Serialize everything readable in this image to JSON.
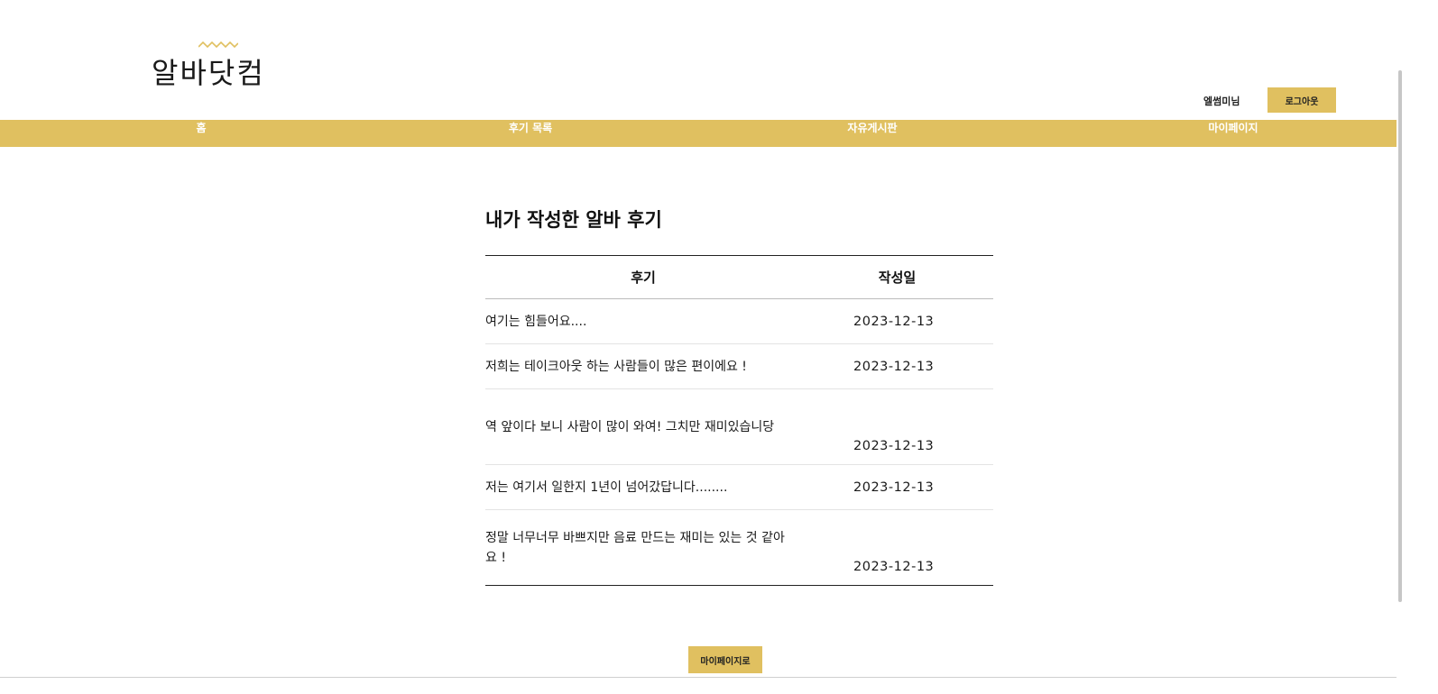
{
  "logo": {
    "text": "알바닷컴",
    "icon": "wave-icon"
  },
  "header": {
    "user_name": "엘썸미님",
    "logout_label": "로그아웃"
  },
  "nav": {
    "items": [
      {
        "label": "홈"
      },
      {
        "label": "후기 목록"
      },
      {
        "label": "자유게시판"
      },
      {
        "label": "마이페이지"
      }
    ]
  },
  "main": {
    "title": "내가 작성한 알바 후기",
    "table": {
      "headers": [
        "후기",
        "작성일"
      ],
      "rows": [
        {
          "review": "여기는 힘들어요....",
          "date": "2023-12-13"
        },
        {
          "review": "저희는 테이크아웃 하는 사람들이 많은 편이에요 !",
          "date": "2023-12-13"
        },
        {
          "review": "역 앞이다 보니 사람이 많이 와여! 그치만 재미있습니당",
          "date": "2023-12-13"
        },
        {
          "review": "저는 여기서 일한지 1년이 넘어갔답니다........",
          "date": "2023-12-13"
        },
        {
          "review": "정말 너무너무 바쁘지만 음료 만드는 재미는 있는 것 같아요 !",
          "date": "2023-12-13"
        }
      ]
    },
    "back_button_label": "마이페이지로"
  },
  "colors": {
    "accent": "#e0c060",
    "nav_text": "#ffffff",
    "text": "#111111"
  }
}
